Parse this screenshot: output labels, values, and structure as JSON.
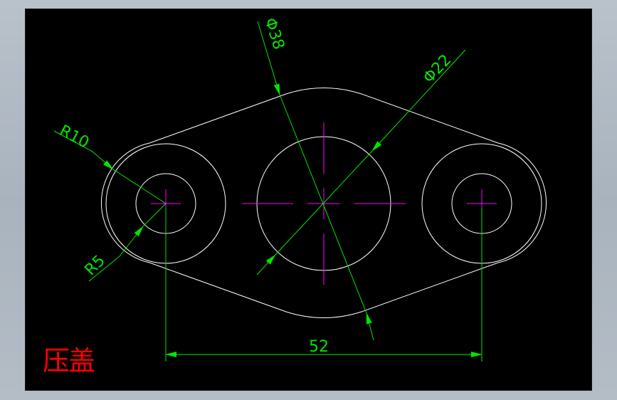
{
  "drawing": {
    "title": "压盖",
    "dimensions": {
      "radius_outer": "R10",
      "radius_inner": "R5",
      "diameter_large": "Φ38",
      "diameter_small": "Φ22",
      "center_distance": "52"
    }
  },
  "colors": {
    "background": "#000000",
    "geometry": "#ffffff",
    "dimension": "#00e600",
    "centerline": "#ff00ff",
    "title": "#ff0000"
  }
}
